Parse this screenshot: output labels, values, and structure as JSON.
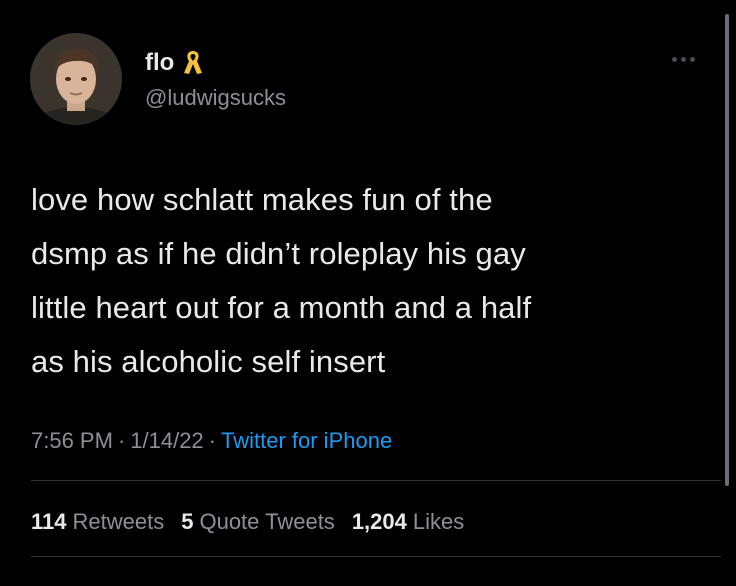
{
  "tweet": {
    "author": {
      "display_name": "flo",
      "badge_icon": "yellow-ribbon-icon",
      "handle": "@ludwigsucks"
    },
    "text": "love how schlatt makes fun of the\ndsmp as if he didn’t roleplay his gay\nlittle heart out for a month and a half\nas his alcoholic self insert",
    "time": "7:56 PM",
    "date": "1/14/22",
    "separator": "·",
    "source": "Twitter for iPhone",
    "stats": {
      "retweets_count": "114",
      "retweets_label": "Retweets",
      "quote_count": "5",
      "quote_label": "Quote Tweets",
      "likes_count": "1,204",
      "likes_label": "Likes"
    }
  },
  "colors": {
    "background": "#000000",
    "text_primary": "#e7e9ea",
    "text_secondary": "#8b9196",
    "link": "#1d9bf0",
    "ribbon": "#f2c23a"
  }
}
